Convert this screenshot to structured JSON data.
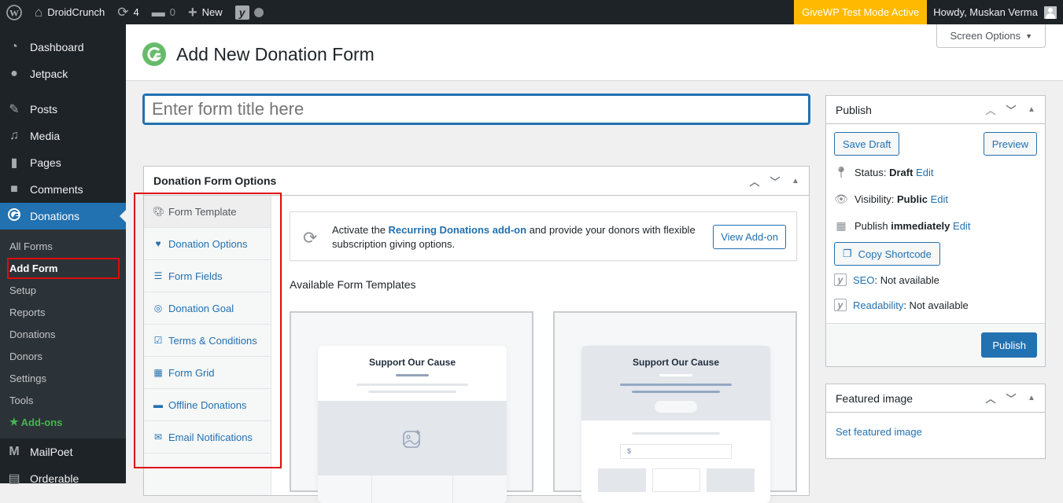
{
  "adminbar": {
    "site_name": "DroidCrunch",
    "updates_count": "4",
    "comments_count": "0",
    "new_label": "New",
    "givewp_badge": "GiveWP Test Mode Active",
    "howdy": "Howdy, Muskan Verma"
  },
  "sidebar": {
    "items": [
      {
        "label": "Dashboard",
        "icon": "dashboard-icon"
      },
      {
        "label": "Jetpack",
        "icon": "jetpack-icon"
      },
      {
        "label": "Posts",
        "icon": "pin-icon"
      },
      {
        "label": "Media",
        "icon": "media-icon"
      },
      {
        "label": "Pages",
        "icon": "pages-icon"
      },
      {
        "label": "Comments",
        "icon": "comment-icon"
      },
      {
        "label": "Donations",
        "icon": "givewp-icon"
      }
    ],
    "submenu": [
      "All Forms",
      "Add Form",
      "Setup",
      "Reports",
      "Donations",
      "Donors",
      "Settings",
      "Tools",
      "Add-ons"
    ],
    "after": [
      {
        "label": "MailPoet",
        "icon": "mailpoet-icon"
      },
      {
        "label": "Orderable",
        "icon": "orderable-icon"
      }
    ]
  },
  "header": {
    "title": "Add New Donation Form",
    "screen_options": "Screen Options"
  },
  "title_input": {
    "placeholder": "Enter form title here",
    "value": ""
  },
  "options_box": {
    "title": "Donation Form Options",
    "tabs": [
      {
        "label": "Form Template",
        "icon": "palette-icon",
        "active": true
      },
      {
        "label": "Donation Options",
        "icon": "heart-icon"
      },
      {
        "label": "Form Fields",
        "icon": "list-icon"
      },
      {
        "label": "Donation Goal",
        "icon": "target-icon"
      },
      {
        "label": "Terms & Conditions",
        "icon": "checkbox-icon"
      },
      {
        "label": "Form Grid",
        "icon": "grid-icon"
      },
      {
        "label": "Offline Donations",
        "icon": "wallet-icon"
      },
      {
        "label": "Email Notifications",
        "icon": "envelope-icon"
      }
    ],
    "notice": {
      "prefix": "Activate the ",
      "link": "Recurring Donations add-on",
      "suffix": " and provide your donors with flexible subscription giving options.",
      "button": "View Add-on"
    },
    "available_title": "Available Form Templates",
    "templates": [
      {
        "title": "Support Our Cause",
        "currency": ""
      },
      {
        "title": "Support Our Cause",
        "currency": "$"
      }
    ]
  },
  "publish": {
    "title": "Publish",
    "save_draft": "Save Draft",
    "preview": "Preview",
    "status_label": "Status: ",
    "status_value": "Draft",
    "visibility_label": "Visibility: ",
    "visibility_value": "Public",
    "publish_label": "Publish ",
    "publish_value": "immediately",
    "edit": "Edit",
    "copy_shortcode": "Copy Shortcode",
    "seo_link": "SEO",
    "seo_value": ": Not available",
    "readability_link": "Readability",
    "readability_value": ": Not available",
    "publish_button": "Publish"
  },
  "featured": {
    "title": "Featured image",
    "link": "Set featured image"
  },
  "colors": {
    "accent": "#2271b1",
    "adminbar": "#1d2327",
    "givewp_badge": "#ffb900",
    "givewp_green": "#66bb6a",
    "highlight_red": "#e00b0b"
  }
}
